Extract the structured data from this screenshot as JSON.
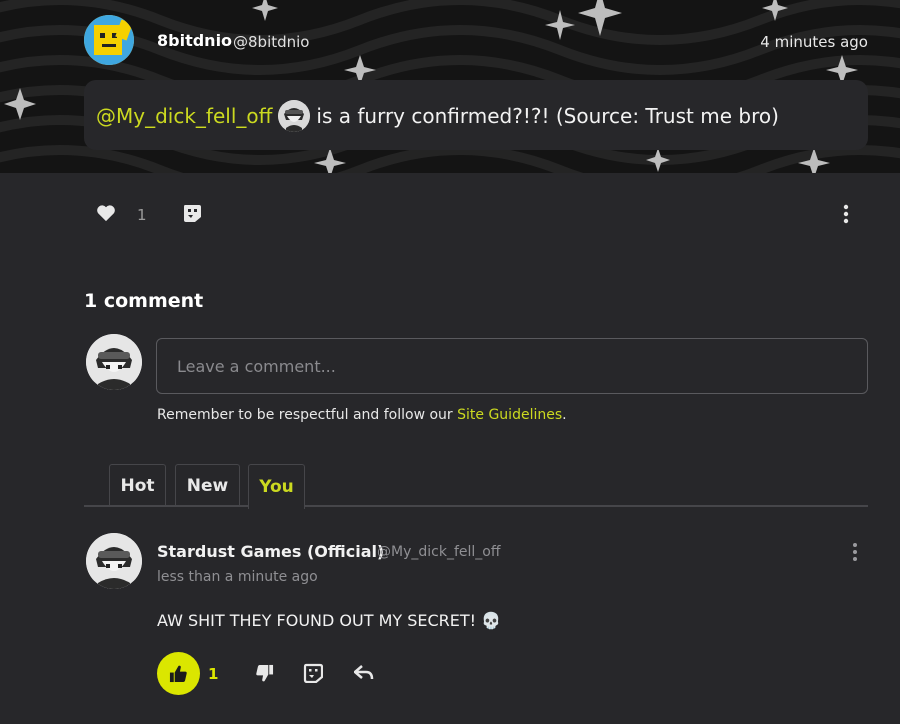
{
  "post": {
    "author_name": "8bitdnio",
    "author_handle": "@8bitdnio",
    "time": "4 minutes ago",
    "mention": "@My_dick_fell_off",
    "text": "is a furry confirmed?!?! (Source: Trust me bro)",
    "like_count": "1"
  },
  "comments": {
    "title": "1 comment",
    "input_placeholder": "Leave a comment...",
    "guidelines_text": "Remember to be respectful and follow our ",
    "guidelines_link": "Site Guidelines",
    "guidelines_end": ".",
    "tabs": [
      {
        "label": "Hot"
      },
      {
        "label": "New"
      },
      {
        "label": "You"
      }
    ],
    "items": [
      {
        "author": "Stardust Games (Official)",
        "handle": "@My_dick_fell_off",
        "time": "less than a minute ago",
        "body": "AW SHIT THEY FOUND OUT MY SECRET! 💀",
        "upvotes": "1"
      }
    ]
  },
  "icons": {
    "like": "heart-icon",
    "remix": "remix-face-icon",
    "more": "more-vertical-icon",
    "upvote": "thumbs-up-icon",
    "downvote": "thumbs-down-icon",
    "reply": "reply-arrow-icon"
  },
  "colors": {
    "accent": "#cbd920",
    "upvote_active": "#dbe600",
    "background": "#27272a",
    "banner": "#141414"
  }
}
